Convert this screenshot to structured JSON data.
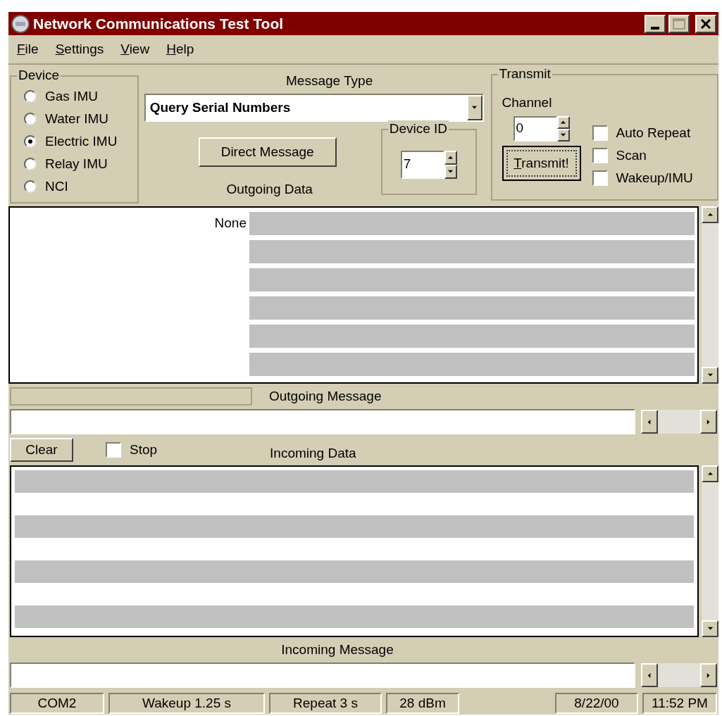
{
  "window": {
    "title": "Network Communications Test Tool"
  },
  "menu": [
    {
      "label": "File"
    },
    {
      "label": "Settings"
    },
    {
      "label": "View"
    },
    {
      "label": "Help"
    }
  ],
  "device": {
    "label": "Device",
    "options": [
      {
        "label": "Gas IMU",
        "selected": false
      },
      {
        "label": "Water IMU",
        "selected": false
      },
      {
        "label": "Electric IMU",
        "selected": true
      },
      {
        "label": "Relay IMU",
        "selected": false
      },
      {
        "label": "NCI",
        "selected": false
      }
    ]
  },
  "message_type": {
    "label": "Message Type",
    "value": "Query Serial Numbers"
  },
  "direct_message_button": "Direct Message",
  "device_id": {
    "label": "Device ID",
    "value": "7"
  },
  "transmit": {
    "label": "Transmit",
    "channel_label": "Channel",
    "channel": "0",
    "button": "Transmit!",
    "options": [
      {
        "label": "Auto Repeat",
        "checked": false
      },
      {
        "label": "Scan",
        "checked": false
      },
      {
        "label": "Wakeup/IMU",
        "checked": false
      }
    ]
  },
  "outgoing_data": {
    "label": "Outgoing Data",
    "column_1": "None"
  },
  "outgoing_progress": {
    "level": 0
  },
  "outgoing_message": {
    "label": "Outgoing Message"
  },
  "clear_button": "Clear",
  "stop": {
    "label": "Stop",
    "checked": false
  },
  "incoming_data": {
    "label": "Incoming Data"
  },
  "incoming_message": {
    "label": "Incoming Message"
  },
  "status_bar": {
    "left": [
      "COM2",
      "Wakeup 1.25 s",
      "Repeat 3 s",
      "28 dBm"
    ],
    "right": [
      "8/22/00",
      "11:52 PM"
    ]
  }
}
